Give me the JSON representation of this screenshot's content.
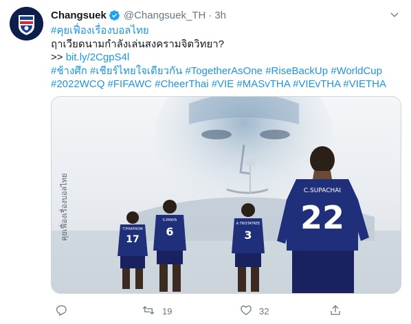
{
  "tweet": {
    "author_name": "Changsuek",
    "handle": "@Changsuek_TH",
    "separator": "·",
    "time": "3h",
    "text_lines": [
      {
        "type": "tag",
        "text": "#คุยเฟื่องเรื่องบอลไทย"
      },
      {
        "type": "plain",
        "text": "ฤาเวียดนามกำลังเล่นสงครามจิตวิทยา?"
      },
      {
        "type": "link_line",
        "prefix": ">> ",
        "link": "bit.ly/2CgpS4l"
      },
      {
        "type": "tags",
        "text": "#ช้างศึก #เชียร์ไทยใจเดียวกัน #TogetherAsOne #RiseBackUp #WorldCup"
      },
      {
        "type": "tags",
        "text": "#2022WCQ #FIFAWC #CheerThai #VIE #MASvTHA #VIEvTHA #VIETHA"
      }
    ],
    "media": {
      "vertical_caption": "คุยเฟื่องเรื่องบอลไทย",
      "players": [
        {
          "jersey_name": "C.SUPACHAI",
          "number": "22"
        },
        {
          "jersey_name": "T.PHAPHOM",
          "number": "17"
        },
        {
          "jersey_name": "S.PANYA",
          "number": "6"
        },
        {
          "jersey_name": "A.TRISTATREE",
          "number": "3"
        }
      ]
    },
    "actions": {
      "reply_icon": "reply-icon",
      "retweet_icon": "retweet-icon",
      "retweet_count": "19",
      "like_icon": "heart-icon",
      "like_count": "32",
      "share_icon": "share-icon"
    },
    "colors": {
      "link": "#1b95e0",
      "muted": "#657786",
      "verified": "#1da1f2",
      "jersey": "#1f2f7a"
    }
  }
}
